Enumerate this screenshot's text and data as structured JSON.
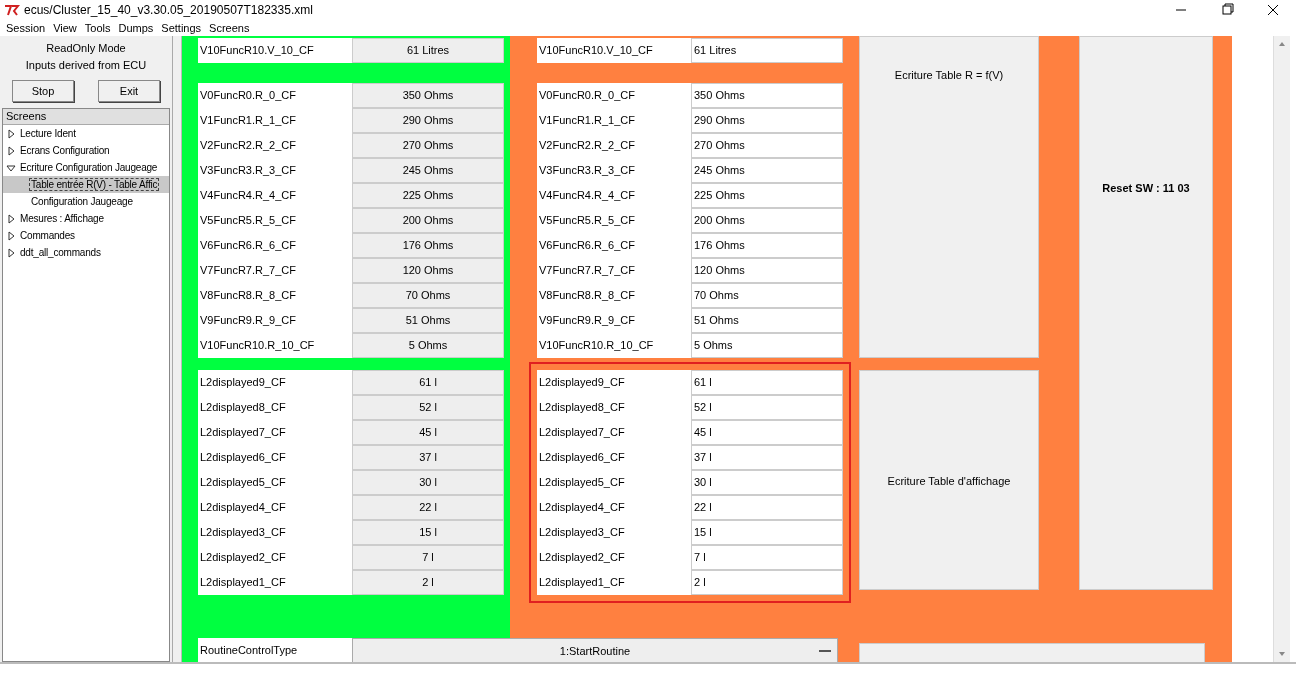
{
  "window": {
    "title": "ecus/Cluster_15_40_v3.30.05_20190507T182335.xml"
  },
  "menu": [
    "Session",
    "View",
    "Tools",
    "Dumps",
    "Settings",
    "Screens"
  ],
  "sidebar": {
    "mode": "ReadOnly Mode",
    "info": "Inputs derived from ECU",
    "buttons": [
      "Stop",
      "Exit"
    ],
    "tree_header": "Screens",
    "tree": [
      {
        "label": "Lecture Ident",
        "expanded": false,
        "selected": false
      },
      {
        "label": "Ecrans Configuration",
        "expanded": false,
        "selected": false
      },
      {
        "label": "Ecriture Configuration Jaugeage",
        "expanded": true,
        "selected": false,
        "children": [
          {
            "label": "Table entrée R(V) - Table Affic",
            "selected": true
          },
          {
            "label": "Configuration Jaugeage",
            "selected": false
          }
        ]
      },
      {
        "label": "Mesures : Affichage",
        "expanded": false,
        "selected": false
      },
      {
        "label": "Commandes",
        "expanded": false,
        "selected": false
      },
      {
        "label": "ddt_all_commands",
        "expanded": false,
        "selected": false
      }
    ]
  },
  "read_panel": {
    "color": "#00ff40",
    "groups": [
      [
        {
          "name": "V10FuncR10.V_10_CF",
          "value": "61 Litres"
        }
      ],
      [
        {
          "name": "V0FuncR0.R_0_CF",
          "value": "350 Ohms"
        },
        {
          "name": "V1FuncR1.R_1_CF",
          "value": "290 Ohms"
        },
        {
          "name": "V2FuncR2.R_2_CF",
          "value": "270 Ohms"
        },
        {
          "name": "V3FuncR3.R_3_CF",
          "value": "245 Ohms"
        },
        {
          "name": "V4FuncR4.R_4_CF",
          "value": "225 Ohms"
        },
        {
          "name": "V5FuncR5.R_5_CF",
          "value": "200 Ohms"
        },
        {
          "name": "V6FuncR6.R_6_CF",
          "value": "176 Ohms"
        },
        {
          "name": "V7FuncR7.R_7_CF",
          "value": "120 Ohms"
        },
        {
          "name": "V8FuncR8.R_8_CF",
          "value": "70 Ohms"
        },
        {
          "name": "V9FuncR9.R_9_CF",
          "value": "51 Ohms"
        },
        {
          "name": "V10FuncR10.R_10_CF",
          "value": "5 Ohms"
        }
      ],
      [
        {
          "name": "L2displayed9_CF",
          "value": "61 l"
        },
        {
          "name": "L2displayed8_CF",
          "value": "52 l"
        },
        {
          "name": "L2displayed7_CF",
          "value": "45 l"
        },
        {
          "name": "L2displayed6_CF",
          "value": "37 l"
        },
        {
          "name": "L2displayed5_CF",
          "value": "30 l"
        },
        {
          "name": "L2displayed4_CF",
          "value": "22 l"
        },
        {
          "name": "L2displayed3_CF",
          "value": "15 l"
        },
        {
          "name": "L2displayed2_CF",
          "value": "7 l"
        },
        {
          "name": "L2displayed1_CF",
          "value": "2 l"
        }
      ]
    ],
    "routine": {
      "label": "RoutineControlType",
      "value": "1:StartRoutine"
    }
  },
  "write_panel": {
    "color": "#ff8040",
    "groups": [
      {
        "highlighted": false,
        "rows": [
          {
            "name": "V10FuncR10.V_10_CF",
            "value": "61 Litres"
          }
        ]
      },
      {
        "highlighted": false,
        "rows": [
          {
            "name": "V0FuncR0.R_0_CF",
            "value": "350 Ohms"
          },
          {
            "name": "V1FuncR1.R_1_CF",
            "value": "290 Ohms"
          },
          {
            "name": "V2FuncR2.R_2_CF",
            "value": "270 Ohms"
          },
          {
            "name": "V3FuncR3.R_3_CF",
            "value": "245 Ohms"
          },
          {
            "name": "V4FuncR4.R_4_CF",
            "value": "225 Ohms"
          },
          {
            "name": "V5FuncR5.R_5_CF",
            "value": "200 Ohms"
          },
          {
            "name": "V6FuncR6.R_6_CF",
            "value": "176 Ohms"
          },
          {
            "name": "V7FuncR7.R_7_CF",
            "value": "120 Ohms"
          },
          {
            "name": "V8FuncR8.R_8_CF",
            "value": "70 Ohms"
          },
          {
            "name": "V9FuncR9.R_9_CF",
            "value": "51 Ohms"
          },
          {
            "name": "V10FuncR10.R_10_CF",
            "value": "5 Ohms"
          }
        ]
      },
      {
        "highlighted": true,
        "rows": [
          {
            "name": "L2displayed9_CF",
            "value": "61 l"
          },
          {
            "name": "L2displayed8_CF",
            "value": "52 l"
          },
          {
            "name": "L2displayed7_CF",
            "value": "45 l"
          },
          {
            "name": "L2displayed6_CF",
            "value": "37 l"
          },
          {
            "name": "L2displayed5_CF",
            "value": "30 l"
          },
          {
            "name": "L2displayed4_CF",
            "value": "22 l"
          },
          {
            "name": "L2displayed3_CF",
            "value": "15 l"
          },
          {
            "name": "L2displayed2_CF",
            "value": "7 l"
          },
          {
            "name": "L2displayed1_CF",
            "value": "2 l"
          }
        ]
      }
    ]
  },
  "action_buttons": [
    {
      "label": "Ecriture Table R = f(V)",
      "kind": "top"
    },
    {
      "label": "Ecriture Table d'affichage",
      "kind": "middle"
    },
    {
      "label": "Reset SW : 11 03",
      "kind": "tall"
    },
    {
      "kind": "cut"
    }
  ]
}
